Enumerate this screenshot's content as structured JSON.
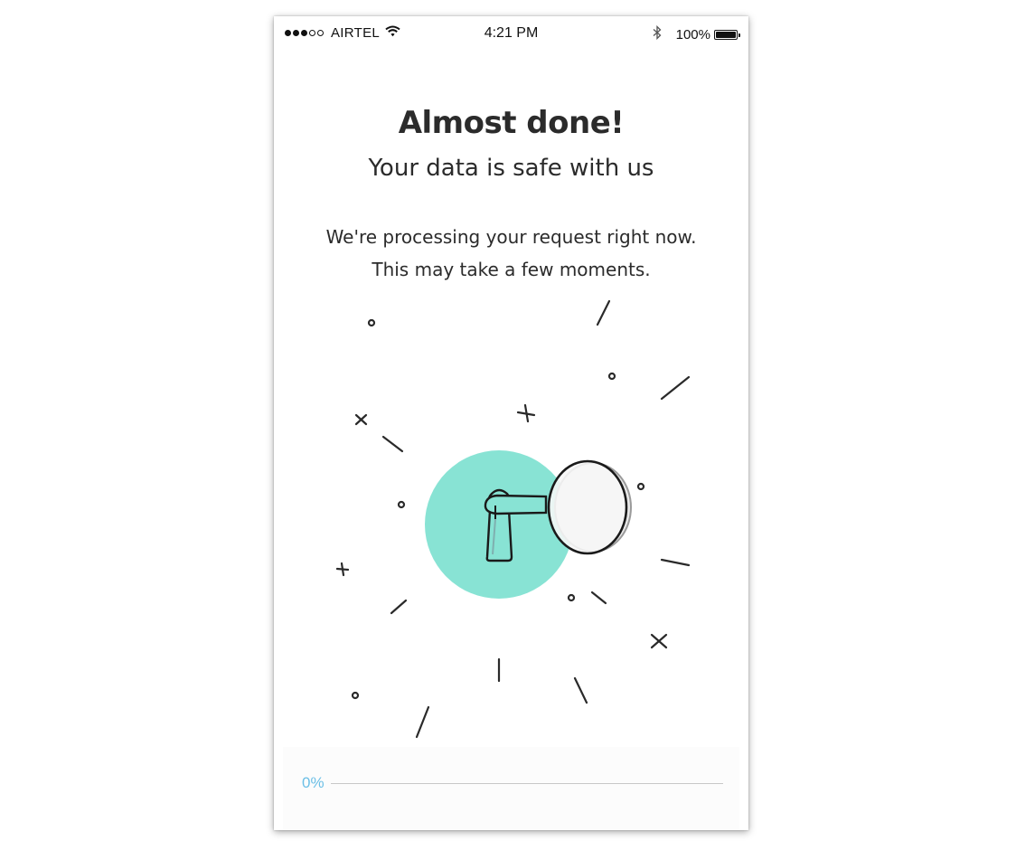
{
  "status_bar": {
    "signal_full": 3,
    "signal_empty": 2,
    "carrier": "AIRTEL",
    "time": "4:21 PM",
    "battery_percent": "100%",
    "icons": [
      "wifi-icon",
      "bluetooth-icon",
      "battery-icon"
    ]
  },
  "content": {
    "title": "Almost done!",
    "subtitle": "Your data is safe with us",
    "message_line1": "We're processing your request right now.",
    "message_line2": "This may take a few moments."
  },
  "illustration": {
    "name": "key-in-keyhole",
    "accent_color": "#88e3d4",
    "stroke_color": "#222222"
  },
  "progress": {
    "label": "0%",
    "value": 0,
    "color": "#6bbfe6"
  }
}
